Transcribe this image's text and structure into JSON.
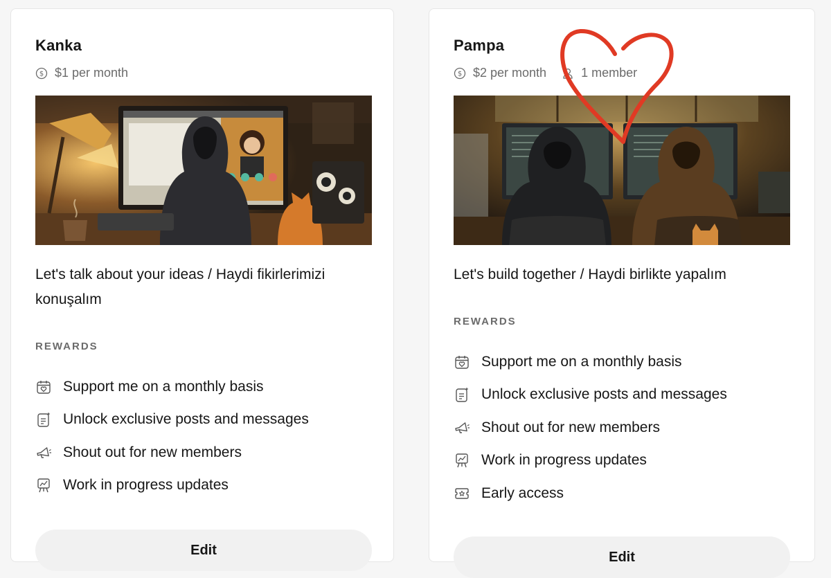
{
  "tiers": [
    {
      "name": "Kanka",
      "price": "$1 per month",
      "description": "Let's talk about your ideas / Haydi fikirlerimizi konuşalım",
      "rewards_label": "REWARDS",
      "rewards": [
        {
          "icon": "calendar-heart-icon",
          "label": "Support me on a monthly basis"
        },
        {
          "icon": "document-sparkle-icon",
          "label": "Unlock exclusive posts and messages"
        },
        {
          "icon": "megaphone-icon",
          "label": "Shout out for new members"
        },
        {
          "icon": "easel-chart-icon",
          "label": "Work in progress updates"
        }
      ],
      "button_label": "Edit"
    },
    {
      "name": "Pampa",
      "price": "$2 per month",
      "members": "1 member",
      "description": "Let's build together / Haydi birlikte yapalım",
      "rewards_label": "REWARDS",
      "rewards": [
        {
          "icon": "calendar-heart-icon",
          "label": "Support me on a monthly basis"
        },
        {
          "icon": "document-sparkle-icon",
          "label": "Unlock exclusive posts and messages"
        },
        {
          "icon": "megaphone-icon",
          "label": "Shout out for new members"
        },
        {
          "icon": "easel-chart-icon",
          "label": "Work in progress updates"
        },
        {
          "icon": "ticket-star-icon",
          "label": "Early access"
        }
      ],
      "button_label": "Edit"
    }
  ],
  "colors": {
    "text": "#161616",
    "muted": "#6b6b6b",
    "card_bg": "#ffffff",
    "button_bg": "#f1f1f1",
    "annotation_heart": "#e03a24"
  }
}
